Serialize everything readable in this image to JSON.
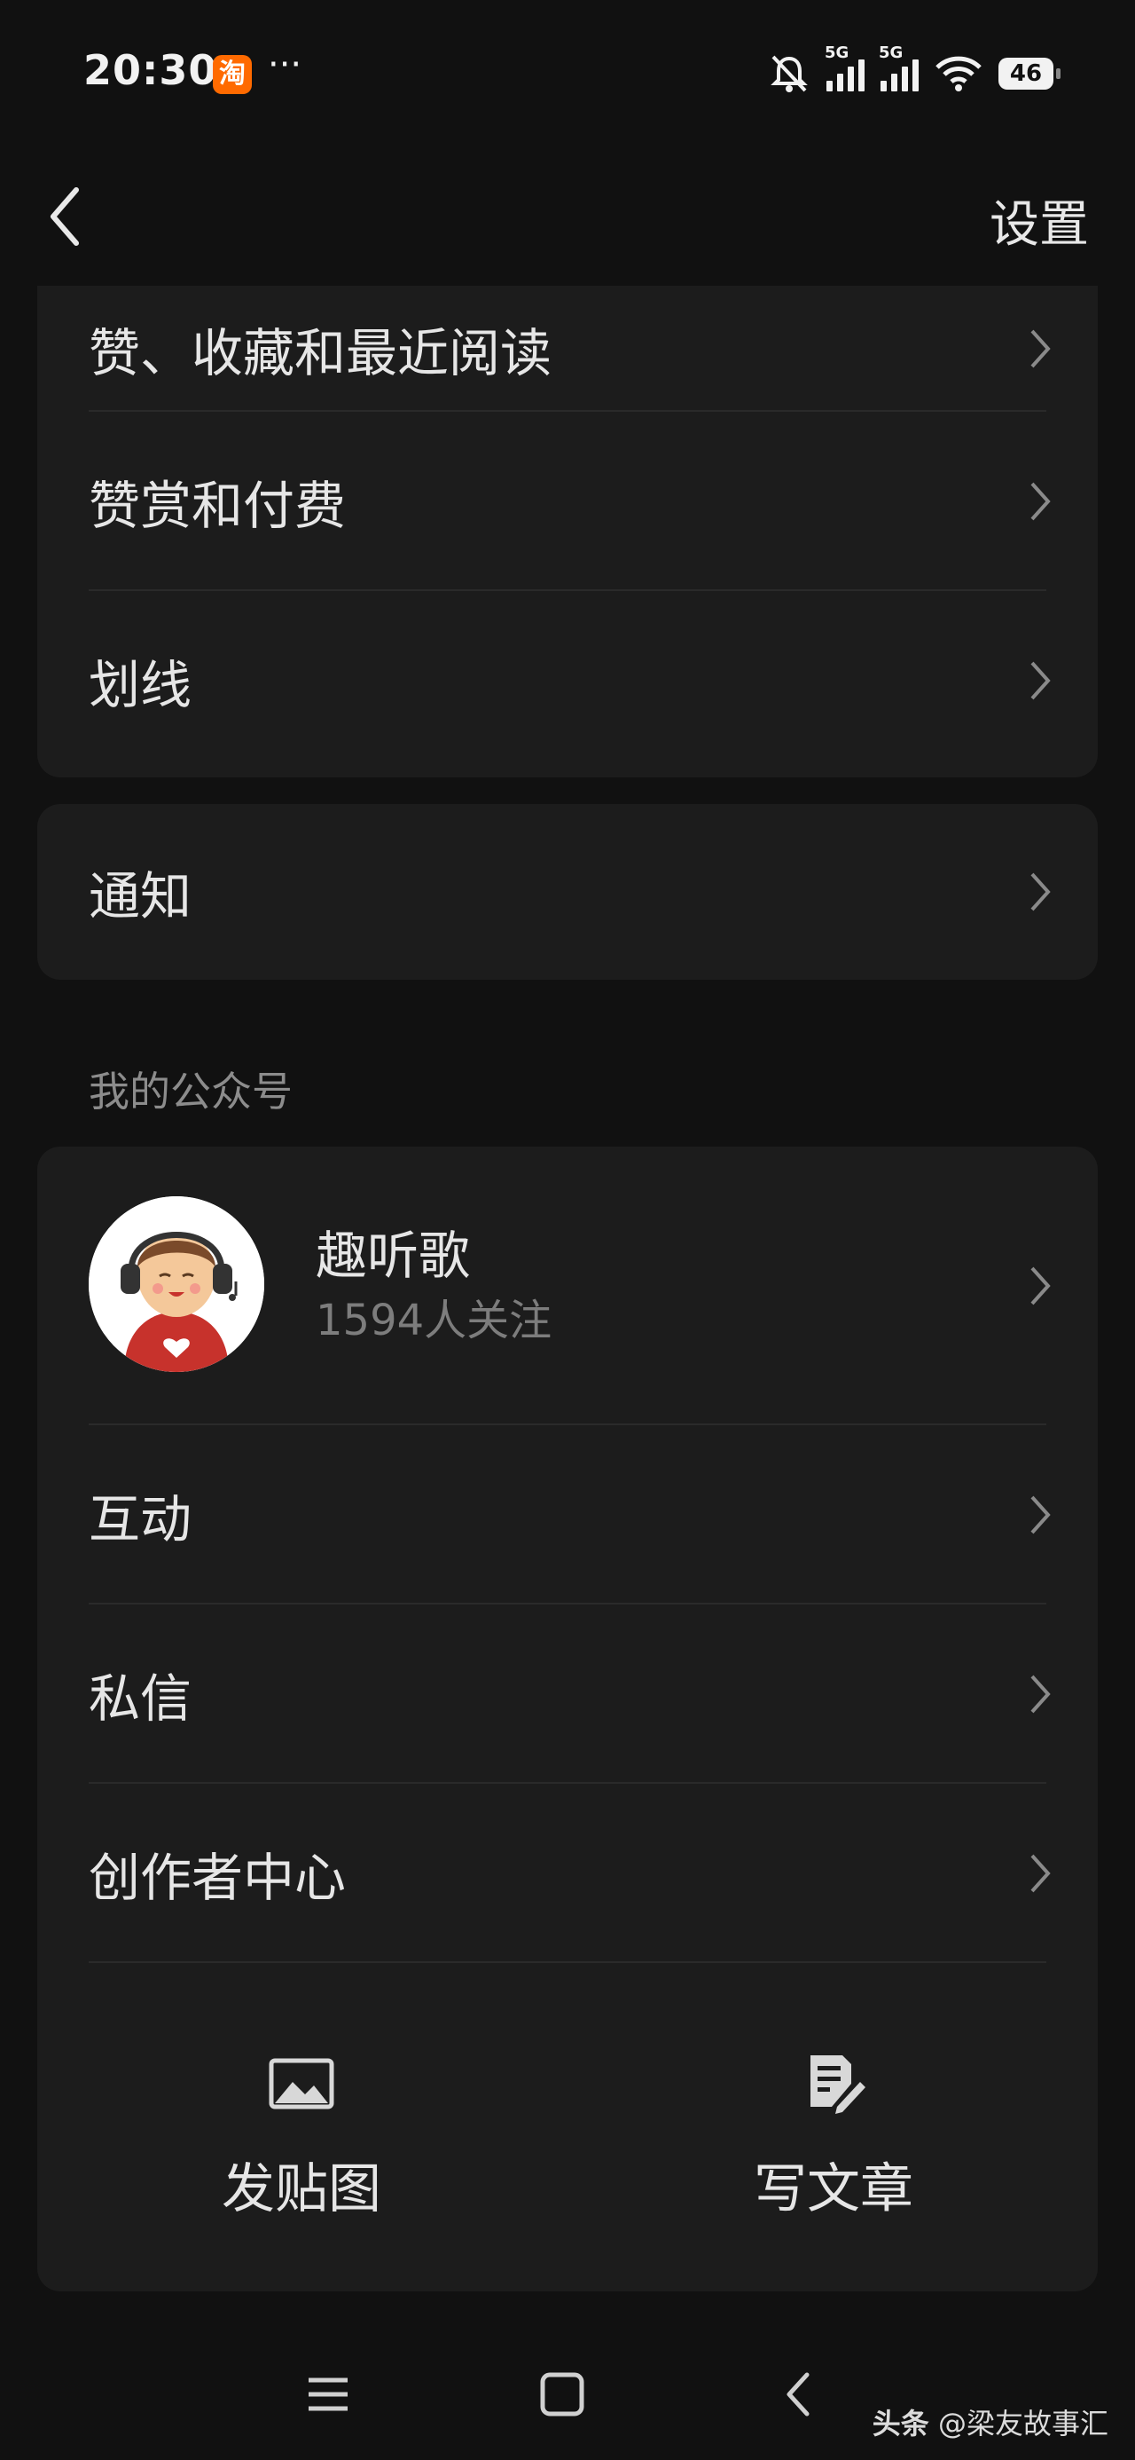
{
  "status_bar": {
    "time": "20:30",
    "app_badge": "淘",
    "more": "···",
    "signal_label_1": "5G",
    "signal_label_2": "5G",
    "battery": "46"
  },
  "header": {
    "title": "设置"
  },
  "card_1": {
    "items": [
      {
        "label": "赞、收藏和最近阅读"
      },
      {
        "label": "赞赏和付费"
      },
      {
        "label": "划线"
      }
    ]
  },
  "card_2": {
    "items": [
      {
        "label": "通知"
      }
    ]
  },
  "section": {
    "title": "我的公众号"
  },
  "account": {
    "name": "趣听歌",
    "followers": "1594人关注"
  },
  "card_3": {
    "items": [
      {
        "label": "互动"
      },
      {
        "label": "私信"
      },
      {
        "label": "创作者中心"
      }
    ]
  },
  "actions": {
    "post_image": "发贴图",
    "write_article": "写文章"
  },
  "watermark": {
    "source": "头条",
    "handle": "@梁友故事汇"
  },
  "colors": {
    "background": "#111111",
    "card": "#1c1c1c",
    "text": "#e6e6e6",
    "muted": "#7d7d7d"
  }
}
